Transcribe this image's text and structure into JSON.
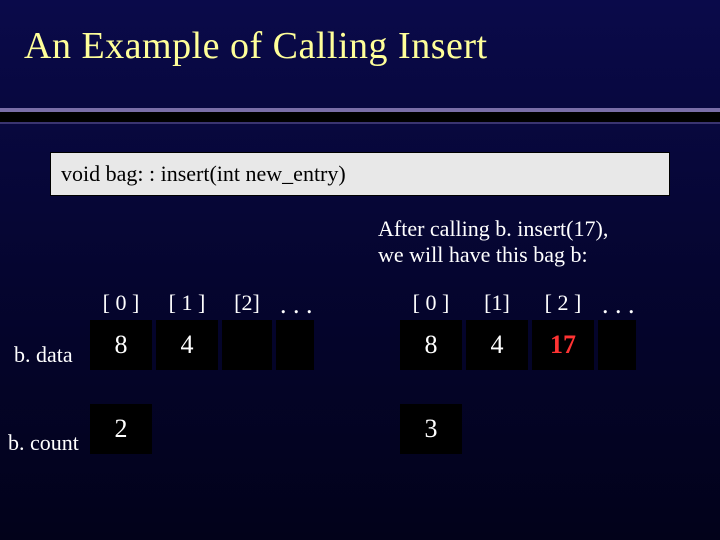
{
  "title": "An Example of Calling Insert",
  "code": "void bag: : insert(int new_entry)",
  "caption_line1": "After calling b. insert(17),",
  "caption_line2": "we will have this bag b:",
  "labels": {
    "data": "b. data",
    "count": "b. count"
  },
  "left_array": {
    "indices": [
      "[ 0 ]",
      "[ 1 ]",
      "[2]"
    ],
    "values": [
      "8",
      "4"
    ],
    "ellipsis": ". . .",
    "count": "2"
  },
  "right_array": {
    "indices": [
      "[ 0 ]",
      "[1]",
      "[ 2 ]"
    ],
    "values": [
      "8",
      "4",
      "17"
    ],
    "ellipsis": ". . .",
    "count": "3",
    "highlight_index": 2
  },
  "chart_data": {
    "type": "table",
    "title": "An Example of Calling Insert",
    "before": {
      "data": [
        8,
        4
      ],
      "count": 2
    },
    "after_call": "b.insert(17)",
    "after": {
      "data": [
        8,
        4,
        17
      ],
      "count": 3
    }
  }
}
